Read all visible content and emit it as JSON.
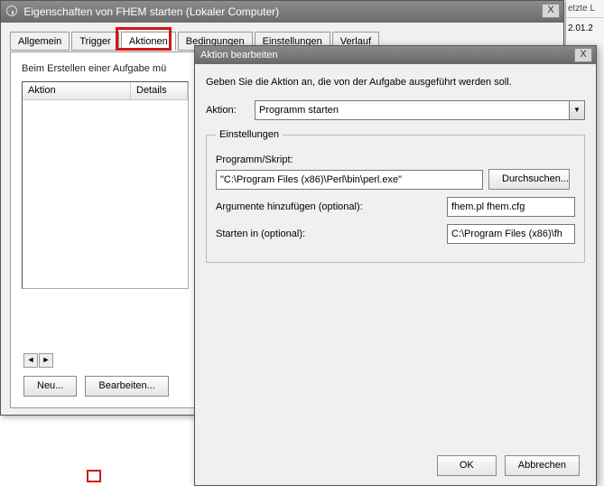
{
  "back_window": {
    "title": "Eigenschaften von FHEM starten (Lokaler Computer)",
    "close": "X",
    "tabs": {
      "allgemein": "Allgemein",
      "trigger": "Trigger",
      "aktionen": "Aktionen",
      "bedingungen": "Bedingungen",
      "einstellungen": "Einstellungen",
      "verlauf": "Verlauf"
    },
    "tab_hint": "Beim Erstellen einer Aufgabe mü",
    "list": {
      "col_aktion": "Aktion",
      "col_details": "Details"
    },
    "buttons": {
      "neu": "Neu...",
      "bearbeiten": "Bearbeiten..."
    },
    "scroll_left": "◄",
    "scroll_right": "►"
  },
  "front_window": {
    "title": "Aktion bearbeiten",
    "close": "X",
    "desc": "Geben Sie die Aktion an, die von der Aufgabe ausgeführt werden soll.",
    "aktion_label": "Aktion:",
    "aktion_value": "Programm starten",
    "drop_glyph": "▼",
    "settings_legend": "Einstellungen",
    "programm_label": "Programm/Skript:",
    "programm_value": "\"C:\\Program Files (x86)\\Perl\\bin\\perl.exe\"",
    "browse": "Durchsuchen...",
    "args_label": "Argumente hinzufügen (optional):",
    "args_value": "fhem.pl fhem.cfg",
    "start_label": "Starten in (optional):",
    "start_value": "C:\\Program Files (x86)\\fh",
    "ok": "OK",
    "cancel": "Abbrechen"
  },
  "sliver": {
    "header": "etzte L",
    "line": "2.01.2"
  }
}
